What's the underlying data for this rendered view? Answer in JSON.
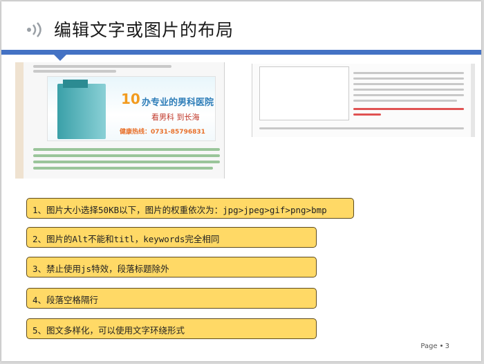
{
  "slide": {
    "title": "编辑文字或图片的布局",
    "items": [
      "1、图片大小选择50KB以下，图片的权重依次为：jpg>jpeg>gif>png>bmp",
      "2、图片的Alt不能和titl，keywords完全相同",
      "3、禁止使用js特效，段落标题除外",
      "4、段落空格隔行",
      "5、图文多样化，可以使用文字环绕形式"
    ],
    "footer": {
      "label": "Page",
      "number": "3"
    }
  },
  "left_image": {
    "banner_number": "10",
    "banner_name": "办专业的男科医院",
    "banner_sub": "看男科 到长海",
    "banner_phone": "健康热线：0731-85796831"
  },
  "colors": {
    "accent_bar": "#4472c4",
    "item_fill": "#ffd966",
    "item_border": "#5c4a1e"
  },
  "icons": [
    "speaker-icon"
  ]
}
